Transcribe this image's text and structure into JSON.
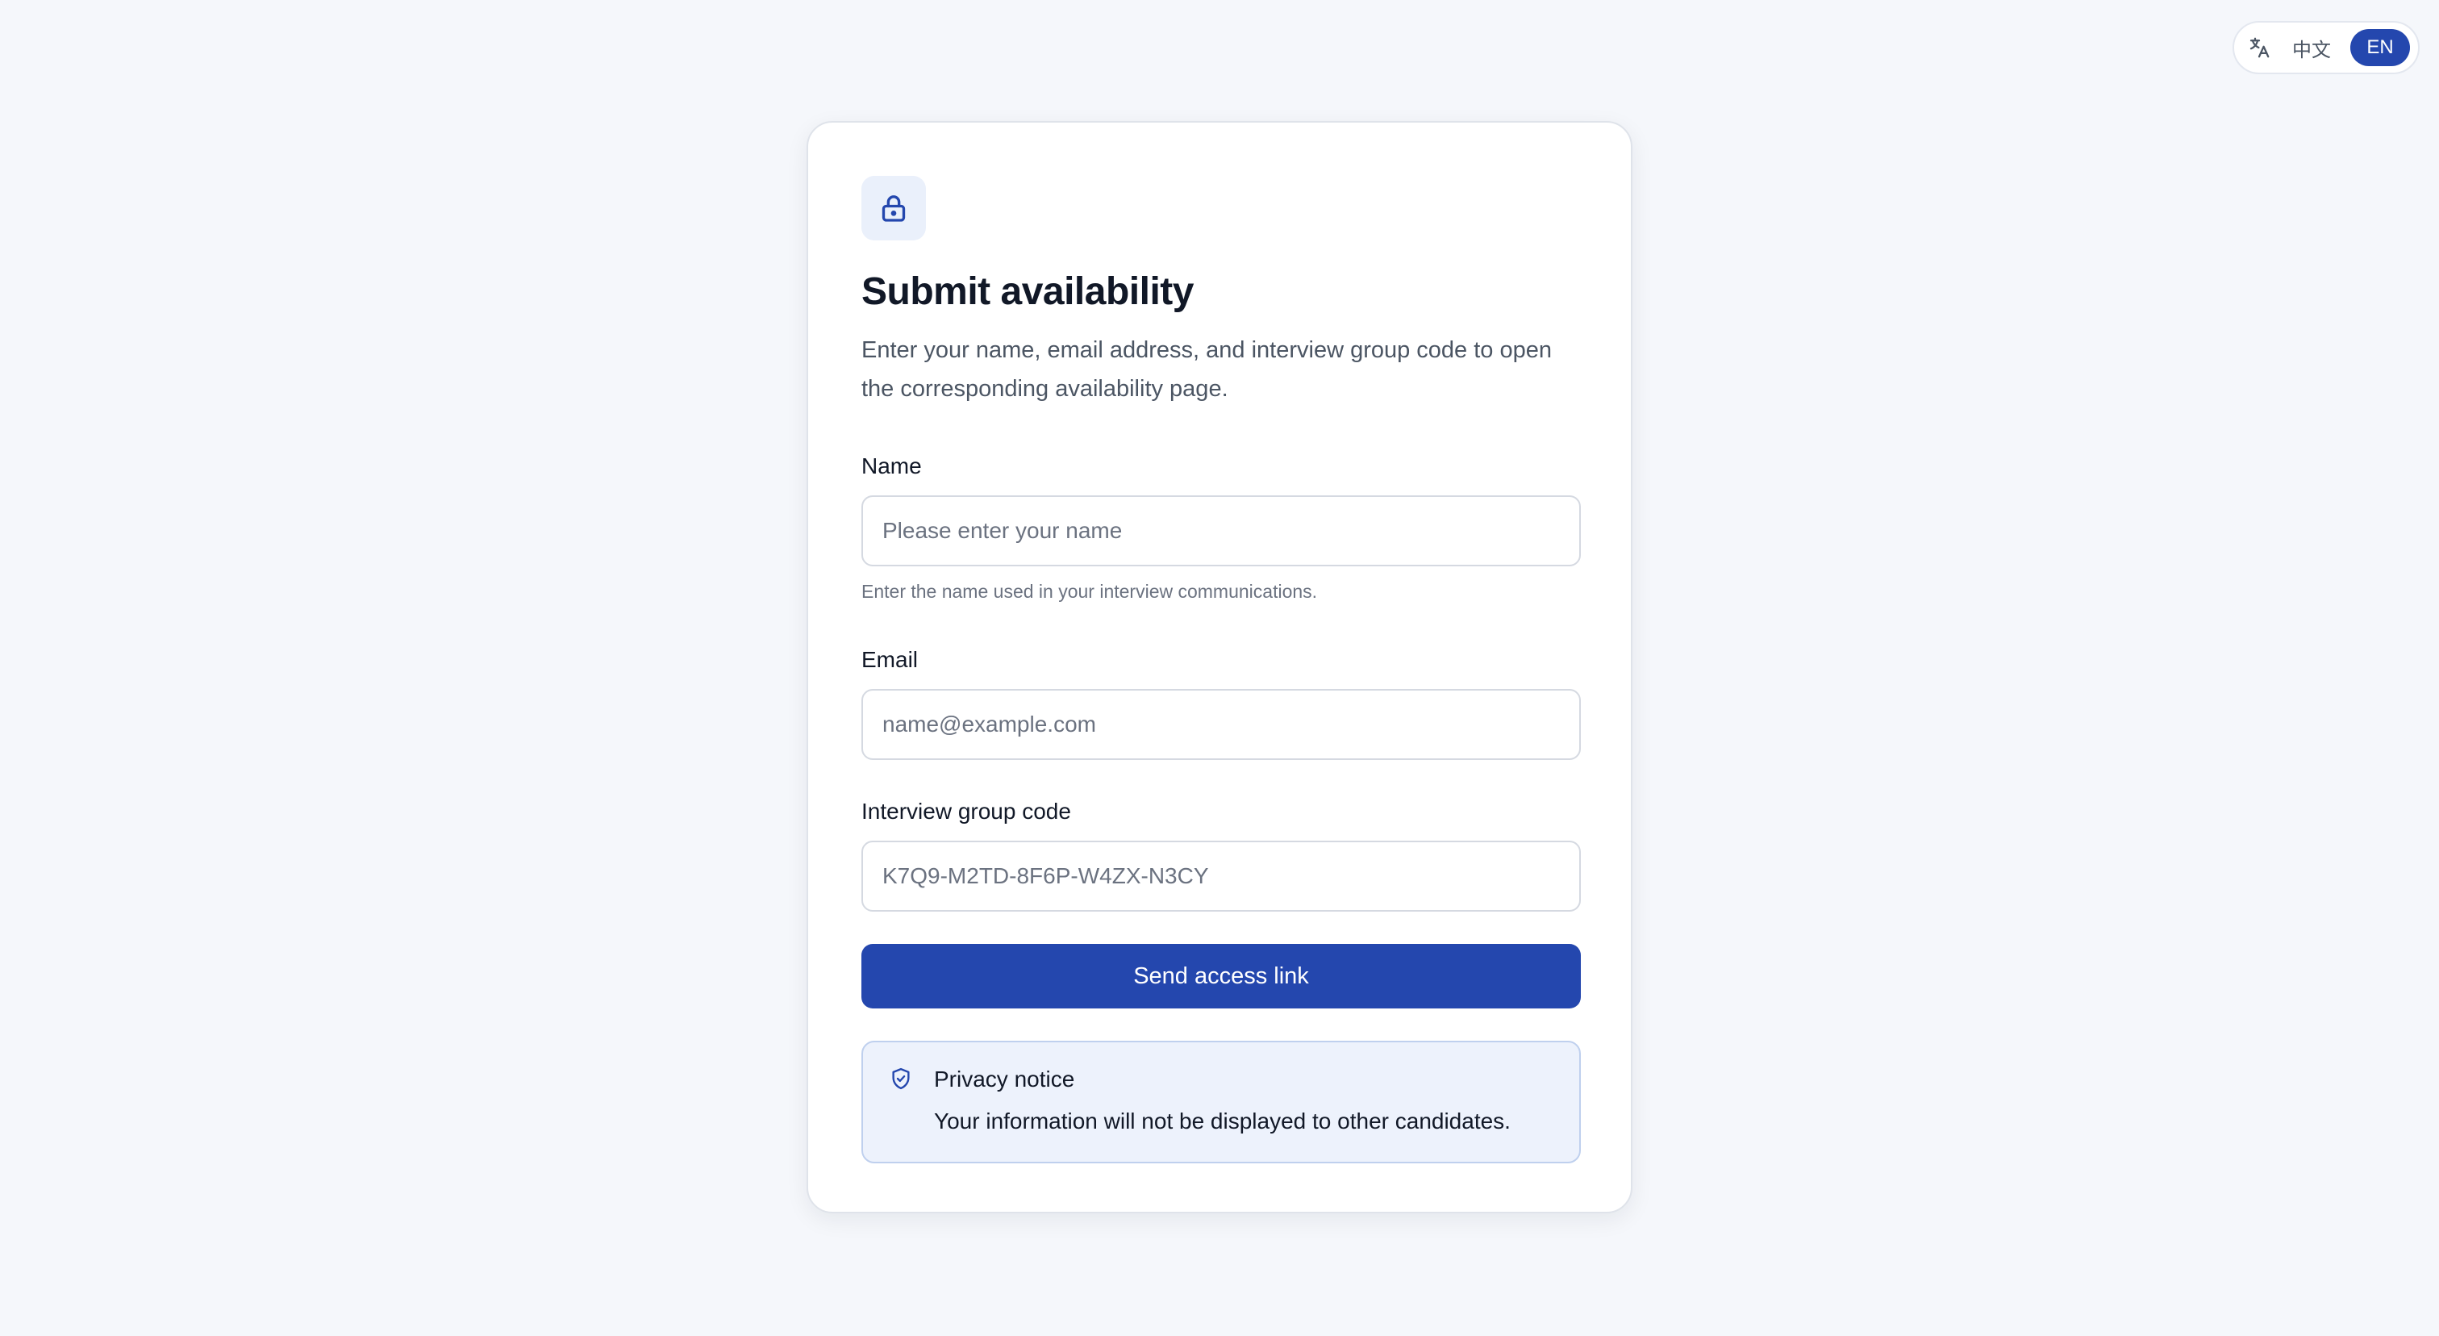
{
  "language_switch": {
    "icon": "translate-icon",
    "options": [
      {
        "label": "中文",
        "active": false
      },
      {
        "label": "EN",
        "active": true
      }
    ]
  },
  "card": {
    "icon": "lock-icon",
    "title": "Submit availability",
    "subtitle": "Enter your name, email address, and interview group code to open the corresponding availability page."
  },
  "form": {
    "name": {
      "label": "Name",
      "placeholder": "Please enter your name",
      "value": "",
      "hint": "Enter the name used in your interview communications."
    },
    "email": {
      "label": "Email",
      "placeholder": "name@example.com",
      "value": ""
    },
    "group_code": {
      "label": "Interview group code",
      "placeholder": "K7Q9-M2TD-8F6P-W4ZX-N3CY",
      "value": ""
    },
    "submit_label": "Send access link"
  },
  "privacy_notice": {
    "icon": "shield-check-icon",
    "title": "Privacy notice",
    "body": "Your information will not be displayed to other candidates."
  },
  "colors": {
    "primary": "#2447ae",
    "background": "#f5f7fb",
    "notice_background": "#edf2fc",
    "notice_border": "#bfd0ee"
  }
}
